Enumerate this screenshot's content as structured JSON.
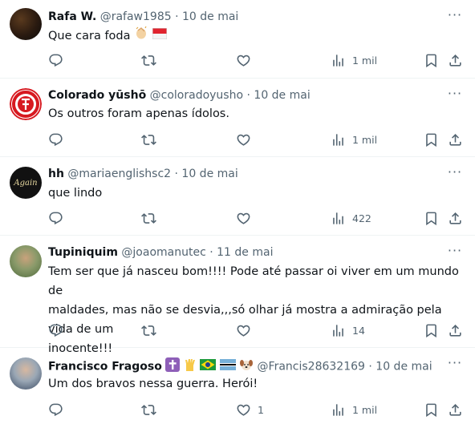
{
  "tweets": [
    {
      "name": "Rafa W.",
      "handle": "@rafaw1985",
      "sep": "·",
      "date": "10 de mai",
      "text": "Que cara foda",
      "emoji": [
        "clapping-hands-emoji",
        "indonesia-flag-emoji"
      ],
      "views": "1 mil",
      "likes": ""
    },
    {
      "name": "Colorado yūshō",
      "handle": "@coloradoyusho",
      "sep": "·",
      "date": "10 de mai",
      "text": "Os outros foram apenas ídolos.",
      "views": "1 mil",
      "likes": ""
    },
    {
      "name": "hh",
      "handle": "@mariaenglishsc2",
      "sep": "·",
      "date": "10 de mai",
      "text": "que lindo",
      "avatar_text": "Again",
      "views": "422",
      "likes": ""
    },
    {
      "name": "Tupiniquim",
      "handle": "@joaomanutec",
      "sep": "·",
      "date": "11 de mai",
      "text_lines": [
        "Tem ser que já nasceu bom!!!! Pode até passar oi viver em um mundo de",
        "maldades, mas não se desvia,,,só olhar já mostra a admiração pela vida de um",
        "inocente!!!"
      ],
      "views": "14",
      "likes": ""
    },
    {
      "name": "Francisco Fragoso",
      "name_emoji": [
        "latin-cross-emoji",
        "vulcan-salute-emoji",
        "brazil-flag-emoji",
        "botswana-flag-emoji",
        "dog-face-emoji"
      ],
      "handle": "@Francis28632169",
      "sep": "·",
      "date": "10 de mai",
      "text": "Um dos bravos nessa guerra. Herói!",
      "views": "1 mil",
      "likes": "1"
    }
  ],
  "colors": {
    "text": "#0f1419",
    "secondary": "#536471",
    "divider": "#eff3f4"
  }
}
